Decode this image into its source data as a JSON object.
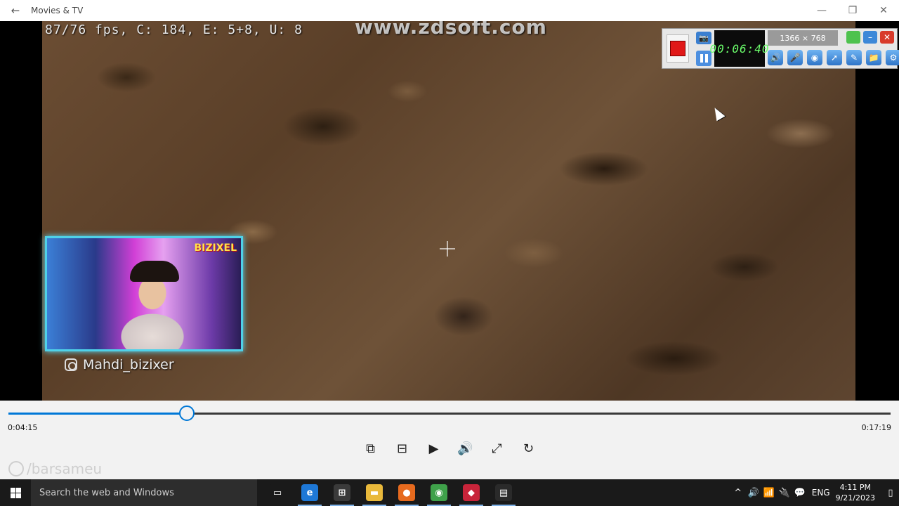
{
  "window": {
    "title": "Movies & TV",
    "back_icon": "←",
    "minimize_icon": "—",
    "restore_icon": "❐",
    "close_icon": "✕"
  },
  "video_overlay": {
    "fps_text": "87/76 fps, C: 184, E: 5+8, U: 8",
    "watermark": "www.zdsoft.com",
    "webcam_tag": "BIZIXEL",
    "streamer_handle": "Mahdi_bizixer"
  },
  "recorder": {
    "timer": "00:06:40",
    "resolution": "1366 × 768",
    "camera_icon": "📷",
    "minimize_icon": "–",
    "close_icon": "✕",
    "tools": [
      "🔊",
      "🎤",
      "◉",
      "➚",
      "✎",
      "📁",
      "⚙"
    ]
  },
  "player": {
    "current_time": "0:04:15",
    "total_time": "0:17:19",
    "progress_fraction": 0.2025,
    "controls": [
      "⧉",
      "⊟",
      "▶",
      "🔊",
      "⤢",
      "↻"
    ]
  },
  "watermark_bottom": "/barsameu",
  "taskbar": {
    "search_placeholder": "Search the web and Windows",
    "apps": [
      {
        "name": "task-view-icon",
        "glyph": "▭",
        "color": "#1a1a1a"
      },
      {
        "name": "edge-icon",
        "glyph": "e",
        "color": "#1e78d6"
      },
      {
        "name": "store-icon",
        "glyph": "⊞",
        "color": "#3a3a3a"
      },
      {
        "name": "file-explorer-icon",
        "glyph": "▬",
        "color": "#e9b93b"
      },
      {
        "name": "firefox-icon",
        "glyph": "●",
        "color": "#e66a1e"
      },
      {
        "name": "chrome-icon",
        "glyph": "◉",
        "color": "#3fa14a"
      },
      {
        "name": "app-red-icon",
        "glyph": "◆",
        "color": "#c8243a"
      },
      {
        "name": "movies-tv-icon",
        "glyph": "▤",
        "color": "#2a2a2a"
      }
    ],
    "tray_icons": [
      "^",
      "🔊",
      "📶",
      "🔌",
      "💬"
    ],
    "language": "ENG",
    "time": "4:11 PM",
    "date": "9/21/2023"
  }
}
